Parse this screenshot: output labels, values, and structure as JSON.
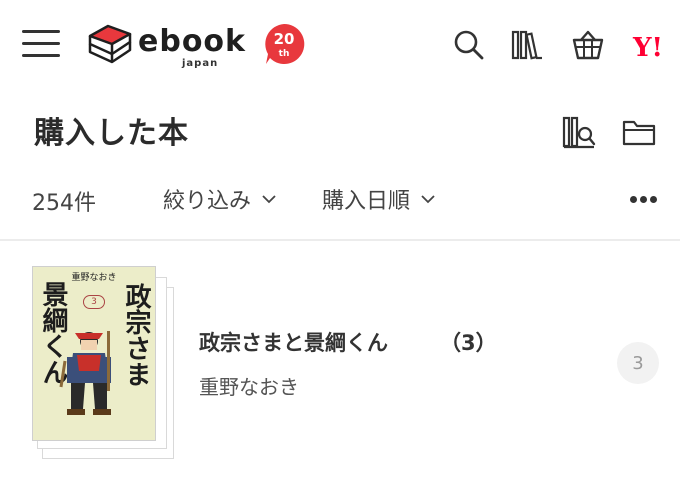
{
  "header": {
    "logo": {
      "brand": "ebook",
      "sub": "japan",
      "anniversary": "20",
      "anniversary_suffix": "th"
    },
    "icons": [
      "menu-icon",
      "search-icon",
      "bookshelf-icon",
      "cart-icon",
      "yahoo-icon"
    ],
    "yahoo_label": "Y!"
  },
  "page": {
    "title": "購入した本",
    "actions": [
      "search-shelf-icon",
      "folder-icon"
    ]
  },
  "toolbar": {
    "count": "254件",
    "filter_label": "絞り込み",
    "sort_label": "購入日順",
    "more_icon": "more-icon"
  },
  "books": [
    {
      "title": "政宗さまと景綱くん",
      "volume": "（3）",
      "author": "重野なおき",
      "badge": "3",
      "cover": {
        "author": "重野なおき",
        "title_left": "景綱くん",
        "title_right": "政宗さま",
        "volume": "3"
      }
    }
  ],
  "colors": {
    "accent": "#e8383d",
    "text": "#333333",
    "divider": "#ececec",
    "cover_bg": "#ecedc9"
  }
}
